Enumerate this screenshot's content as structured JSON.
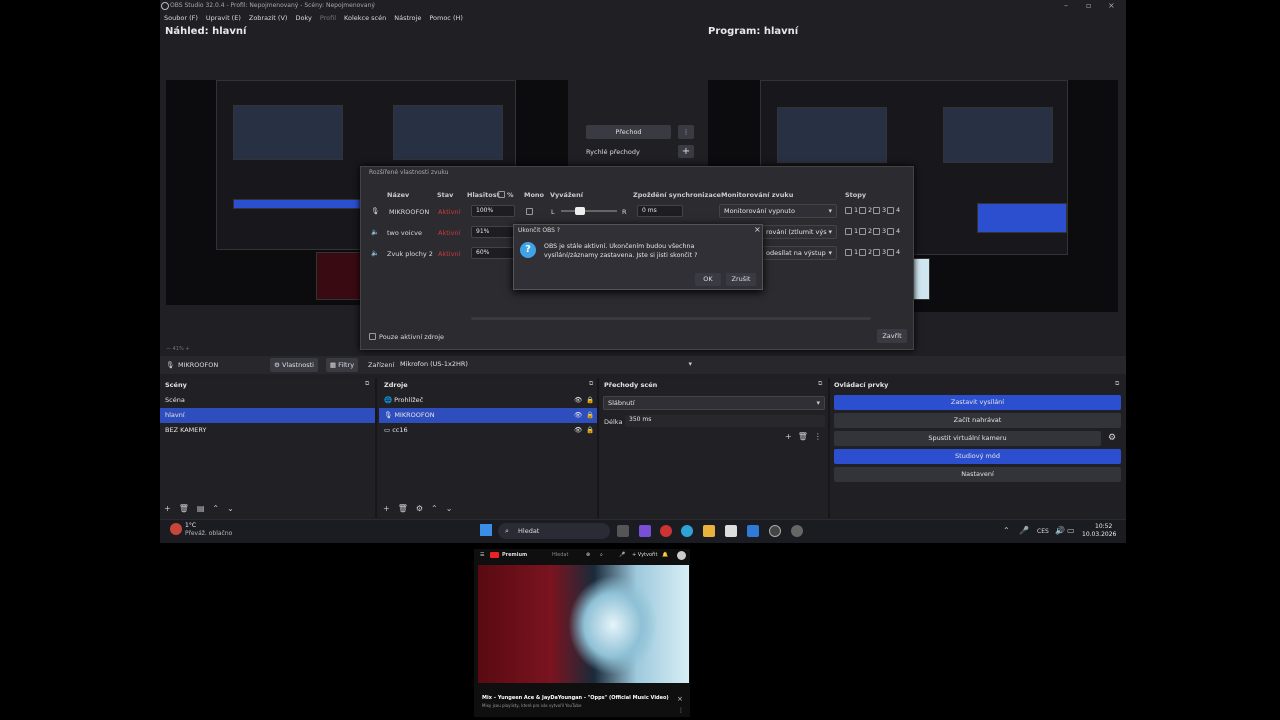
{
  "window": {
    "title": "OBS Studio 32.0.4 - Profil: Nepojmenovaný - Scény: Nepojmenovaný"
  },
  "menu": [
    "Soubor (F)",
    "Upravit (E)",
    "Zobrazit (V)",
    "Doky",
    "Profil",
    "Kolekce scén",
    "Nástroje",
    "Pomoc (H)"
  ],
  "preview": {
    "title": "Náhled: hlavní"
  },
  "program": {
    "title": "Program: hlavní"
  },
  "transition": {
    "button": "Přechod",
    "quick": "Rychlé přechody"
  },
  "audio_dialog": {
    "title": "Rozšířené vlastnosti zvuku",
    "headers": [
      "Název",
      "Stav",
      "Hlasitost",
      "%",
      "Mono",
      "Vyvážení",
      "Zpoždění synchronizace",
      "Monitorování zvuku",
      "Stopy"
    ],
    "rows": [
      {
        "name": "MIKROOFON",
        "status": "Aktivní",
        "volume": "100%",
        "sync": "0 ms",
        "monitor": "Monitorování vypnuto"
      },
      {
        "name": "two voicve",
        "status": "Aktivní",
        "volume": "91%",
        "sync": "0 ms",
        "monitor": "rování (ztlumit výs"
      },
      {
        "name": "Zvuk plochy 2",
        "status": "Aktivní",
        "volume": "60%",
        "sync": "0 ms",
        "monitor": "odesílat na výstup"
      }
    ],
    "balance_left": "L",
    "balance_right": "R",
    "tracks": [
      "1",
      "2",
      "3",
      "4"
    ],
    "only_active": "Pouze aktivní zdroje",
    "close": "Zavřít"
  },
  "confirm": {
    "title": "Ukončit OBS ?",
    "message": "OBS je stále aktivní. Ukončením budou všechna vysílání/záznamy zastavena. Jste si jisti skončit ?",
    "ok": "OK",
    "cancel": "Zrušit"
  },
  "source_bar": {
    "name": "MIKROOFON",
    "properties": "Vlastnosti",
    "filters": "Filtry",
    "device_label": "Zařízení",
    "device": "Mikrofon (US-1x2HR)"
  },
  "scenes": {
    "title": "Scény",
    "items": [
      "Scéna",
      "hlavní",
      "BEZ KAMERY"
    ],
    "selected": 1
  },
  "sources": {
    "title": "Zdroje",
    "items": [
      "Prohlížeč",
      "MIKROOFON",
      "cc16"
    ],
    "selected": 1
  },
  "transitions": {
    "title": "Přechody scén",
    "type": "Slábnutí",
    "duration_label": "Délka",
    "duration": "350 ms"
  },
  "controls": {
    "title": "Ovládací prvky",
    "buttons": [
      "Zastavit vysílání",
      "Začít nahrávat",
      "Spustit virtuální kameru",
      "Studiový mód",
      "Nastavení"
    ]
  },
  "taskbar": {
    "weather_temp": "1°C",
    "weather_desc": "Převáž. oblačno",
    "search": "Hledat",
    "lang": "CES",
    "time": "10:52",
    "date": "10.03.2026"
  },
  "phone": {
    "brand": "Premium",
    "tab": "Hledat",
    "create": "Vytvořit",
    "video_title": "Mix – Yungeen Ace & JayDaYoungan - \"Opps\" (Official Music Video)",
    "video_sub": "Mixy jsou playlisty, které pro vás vytvořil YouTube"
  },
  "colors": {
    "accent": "#2b4fcf",
    "status_active": "#cc3a3a",
    "bg": "#1f1f24"
  }
}
